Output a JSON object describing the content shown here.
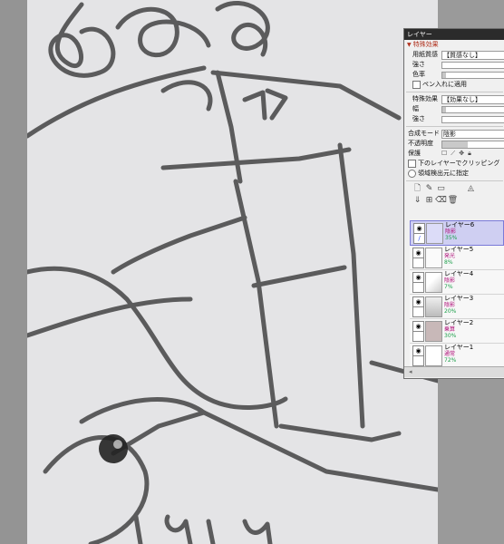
{
  "panel": {
    "title": "レイヤー",
    "section_title": "特殊効果",
    "paper_texture_label": "用紙質感",
    "paper_texture_value": "【質感なし】",
    "strength_label": "強さ",
    "color_rate_label": "色率",
    "pen_apply_label": "ペン入れに適用",
    "effect_label": "特殊効果",
    "effect_value": "【効果なし】",
    "width_label": "幅",
    "strength2_label": "強さ",
    "blend_mode_label": "合成モード",
    "blend_mode_value": "陰影",
    "opacity_label": "不透明度",
    "opacity_level": 0.35,
    "protect_label": "保護",
    "clip_label": "下のレイヤーでクリッピング",
    "source_label": "領域検出元に指定"
  },
  "layers": [
    {
      "name": "レイヤー6",
      "mode": "陰影",
      "opacity": "35%",
      "selected": true
    },
    {
      "name": "レイヤー5",
      "mode": "発光",
      "opacity": "8%",
      "selected": false
    },
    {
      "name": "レイヤー4",
      "mode": "陰影",
      "opacity": "7%",
      "selected": false
    },
    {
      "name": "レイヤー3",
      "mode": "陰影",
      "opacity": "20%",
      "selected": false
    },
    {
      "name": "レイヤー2",
      "mode": "乗算",
      "opacity": "30%",
      "selected": false
    },
    {
      "name": "レイヤー1",
      "mode": "通常",
      "opacity": "72%",
      "selected": false
    }
  ],
  "colors": {
    "section_title": "#b1321e",
    "mode_text": "#b0107a",
    "opacity_text": "#1ea04c",
    "selected_layer": "#cfcff2"
  }
}
